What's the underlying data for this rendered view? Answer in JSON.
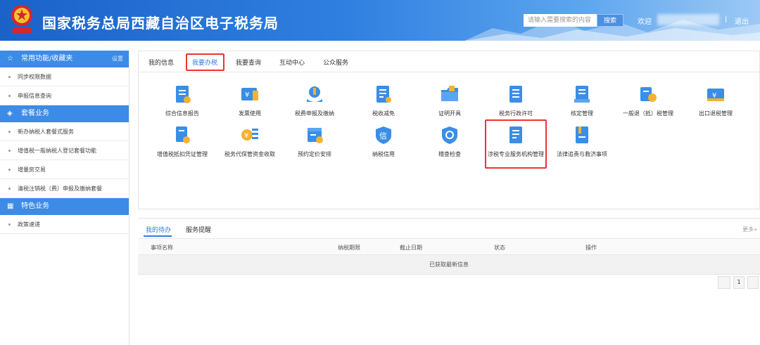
{
  "header": {
    "title": "国家税务总局西藏自治区电子税务局",
    "search_placeholder": "请输入需要搜索的内容",
    "search_button": "搜索",
    "welcome": "欢迎",
    "separator": "|",
    "logout": "退出",
    "brand_color": "#2f7fe0"
  },
  "sidebar": {
    "sections": [
      {
        "title": "常用功能/收藏夹",
        "icon": "star-icon",
        "setting": "设置",
        "items": [
          "同步权限数据",
          "申报信息查询"
        ]
      },
      {
        "title": "套餐业务",
        "icon": "layers-icon",
        "items": [
          "新办纳税人套餐式服务",
          "增值税一般纳税人登记套餐功能",
          "增量房交易",
          "清税注销税（费）申报及缴纳套餐"
        ]
      },
      {
        "title": "特色业务",
        "icon": "grid-icon",
        "items": [
          "政策速递"
        ]
      }
    ]
  },
  "main": {
    "tabs": [
      "我的信息",
      "我要办税",
      "我要查询",
      "互动中心",
      "公众服务"
    ],
    "active_tab": "我要办税",
    "functions_row1": [
      "综合信息报告",
      "发票使用",
      "税费申报及缴纳",
      "税收减免",
      "证明开具",
      "税务行政许可",
      "核定管理",
      "一般退（抵）税管理",
      "出口退税管理"
    ],
    "functions_row2": [
      "增值税抵扣凭证管理",
      "税务代保管资金收取",
      "预约定价安排",
      "纳税信用",
      "稽查检查",
      "涉税专业服务机构管理",
      "法律追责与救济事项"
    ],
    "highlight_color": "#ee3333"
  },
  "todo": {
    "tabs": [
      "我的待办",
      "服务提醒"
    ],
    "more": "更多»",
    "columns": [
      "事项名称",
      "纳税期限",
      "截止日期",
      "状态",
      "操作"
    ],
    "empty_message": "已获取最新信息",
    "page": "1"
  }
}
